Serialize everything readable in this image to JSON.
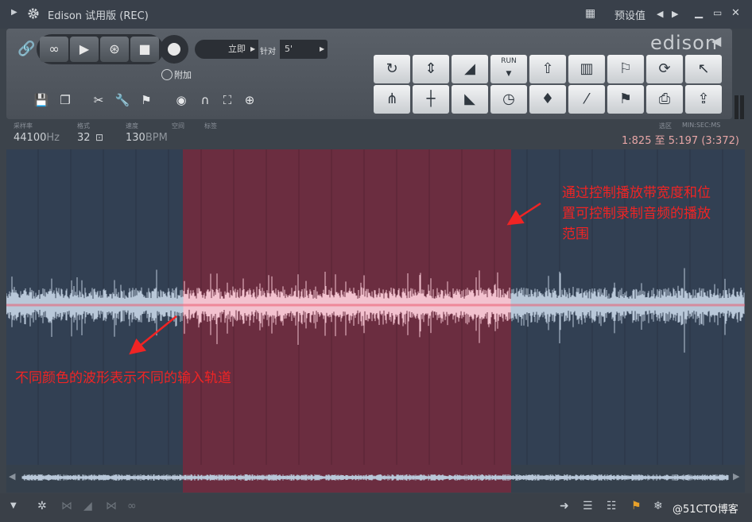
{
  "window": {
    "title": "Edison 试用版 (REC)",
    "preset_label": "预设值"
  },
  "transport": {
    "mode_value": "立即",
    "snap_label": "针对",
    "snap_value": "5'",
    "append_label": "附加"
  },
  "logo": "edison",
  "grid_icons": [
    "rotate-icon",
    "split-icon",
    "fade-icon",
    "run-icon",
    "rocket-icon",
    "bars-icon",
    "marker-add-icon",
    "loop-icon",
    "cursor-icon",
    "tuning-fork-icon",
    "spectrum-icon",
    "decay-icon",
    "clock-icon",
    "drop-icon",
    "feather-icon",
    "marker-tag-icon",
    "save-icon",
    "export-icon"
  ],
  "grid_run_label": "RUN",
  "info": {
    "samplerate_label": "采样率",
    "samplerate": "44100",
    "samplerate_unit": "Hz",
    "format_label": "格式",
    "format": "32",
    "tempo_label": "速度",
    "tempo": "130",
    "tempo_unit": "BPM",
    "space_label": "空间",
    "marker_label": "标签",
    "selection_label": "选区",
    "time_label": "MIN:SEC:MS",
    "position": "1:825 至 5:197 (3:372)"
  },
  "selection": {
    "start": 0.239,
    "end": 0.683
  },
  "annotations": {
    "right_line1": "通过控制播放带宽度和位",
    "right_line2": "置可控制录制音频的播放",
    "right_line3": "范围",
    "left": "不同颜色的波形表示不同的输入轨道"
  },
  "watermark": "@51CTO博客",
  "colors": {
    "selection": "#6b2d40",
    "wave_outside": "#b9c8d9",
    "wave_inside": "#f3c2cf",
    "annotation": "#f02424",
    "link_green": "#9bc34a",
    "position_text": "#e7a6a6"
  }
}
